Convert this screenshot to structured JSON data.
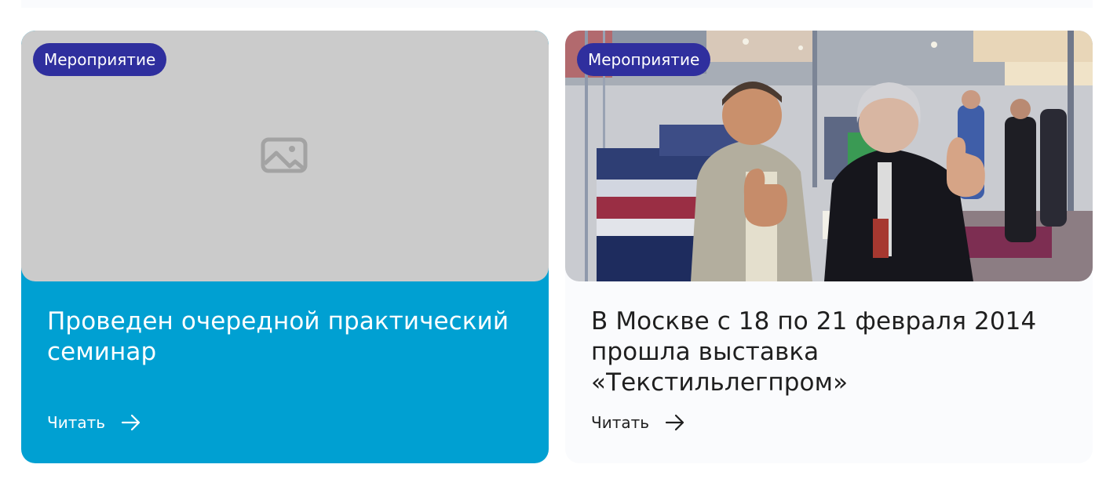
{
  "cards": [
    {
      "badge": "Мероприятие",
      "title": "Проведен очередной практический семинар",
      "read_label": "Читать",
      "image": "image-placeholder-icon",
      "background": "#00a0d2"
    },
    {
      "badge": "Мероприятие",
      "title": "В Москве с 18 по 21 февраля 2014 прошла выставка «Текстильлегпром»",
      "read_label": "Читать",
      "image": "exhibition-photo",
      "background": "#fafbfd"
    }
  ],
  "colors": {
    "badge": "#2f2f9e",
    "accent": "#00a0d2",
    "placeholder": "#cbcbcb",
    "text_dark": "#1f1f1f"
  }
}
